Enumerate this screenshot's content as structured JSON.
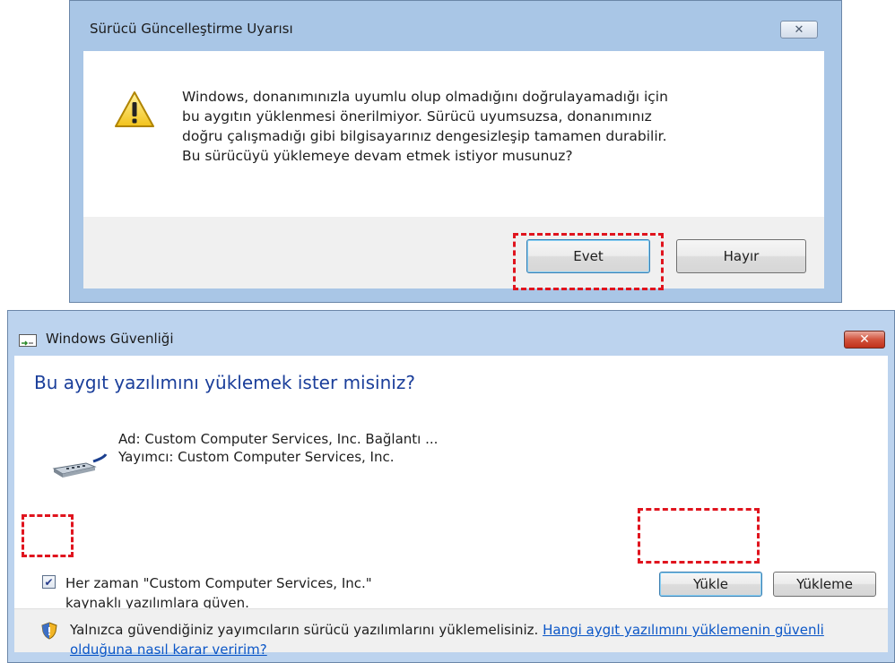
{
  "dialog1": {
    "title": "Sürücü Güncelleştirme Uyarısı",
    "close_glyph": "✕",
    "message_lines": [
      "Windows, donanımınızla uyumlu olup olmadığını doğrulayamadığı için",
      "bu aygıtın yüklenmesi önerilmiyor.  Sürücü uyumsuzsa, donanımınız",
      "doğru çalışmadığı gibi bilgisayarınız dengesizleşip tamamen durabilir.",
      "Bu sürücüyü yüklemeye devam etmek istiyor musunuz?"
    ],
    "yes_label": "Evet",
    "no_label": "Hayır",
    "icon": "warning-icon"
  },
  "dialog2": {
    "title": "Windows Güvenliği",
    "close_glyph": "✕",
    "heading": "Bu aygıt yazılımını yüklemek ister misiniz?",
    "device_name": "Ad: Custom Computer Services, Inc. Bağlantı ...",
    "publisher": "Yayımcı: Custom Computer Services, Inc.",
    "trust_checkbox_checked": true,
    "trust_check_glyph": "✔",
    "trust_line1": "Her zaman \"Custom Computer Services, Inc.\"",
    "trust_line2": "kaynaklı yazılımlara güven.",
    "install_label": "Yükle",
    "dont_install_label": "Yükleme",
    "footer_text": "Yalnızca güvendiğiniz yayımcıların sürücü yazılımlarını yüklemelisiniz.",
    "footer_link": "Hangi aygıt yazılımını yüklemenin güvenli olduğuna nasıl karar veririm?",
    "icons": [
      "window-icon",
      "device-connector-icon",
      "shield-icon"
    ]
  },
  "colors": {
    "highlight_dash": "#e0141e",
    "heading_blue": "#1a3e9a",
    "link_blue": "#0b56c7",
    "frame_blue": "#a9c6e6"
  }
}
